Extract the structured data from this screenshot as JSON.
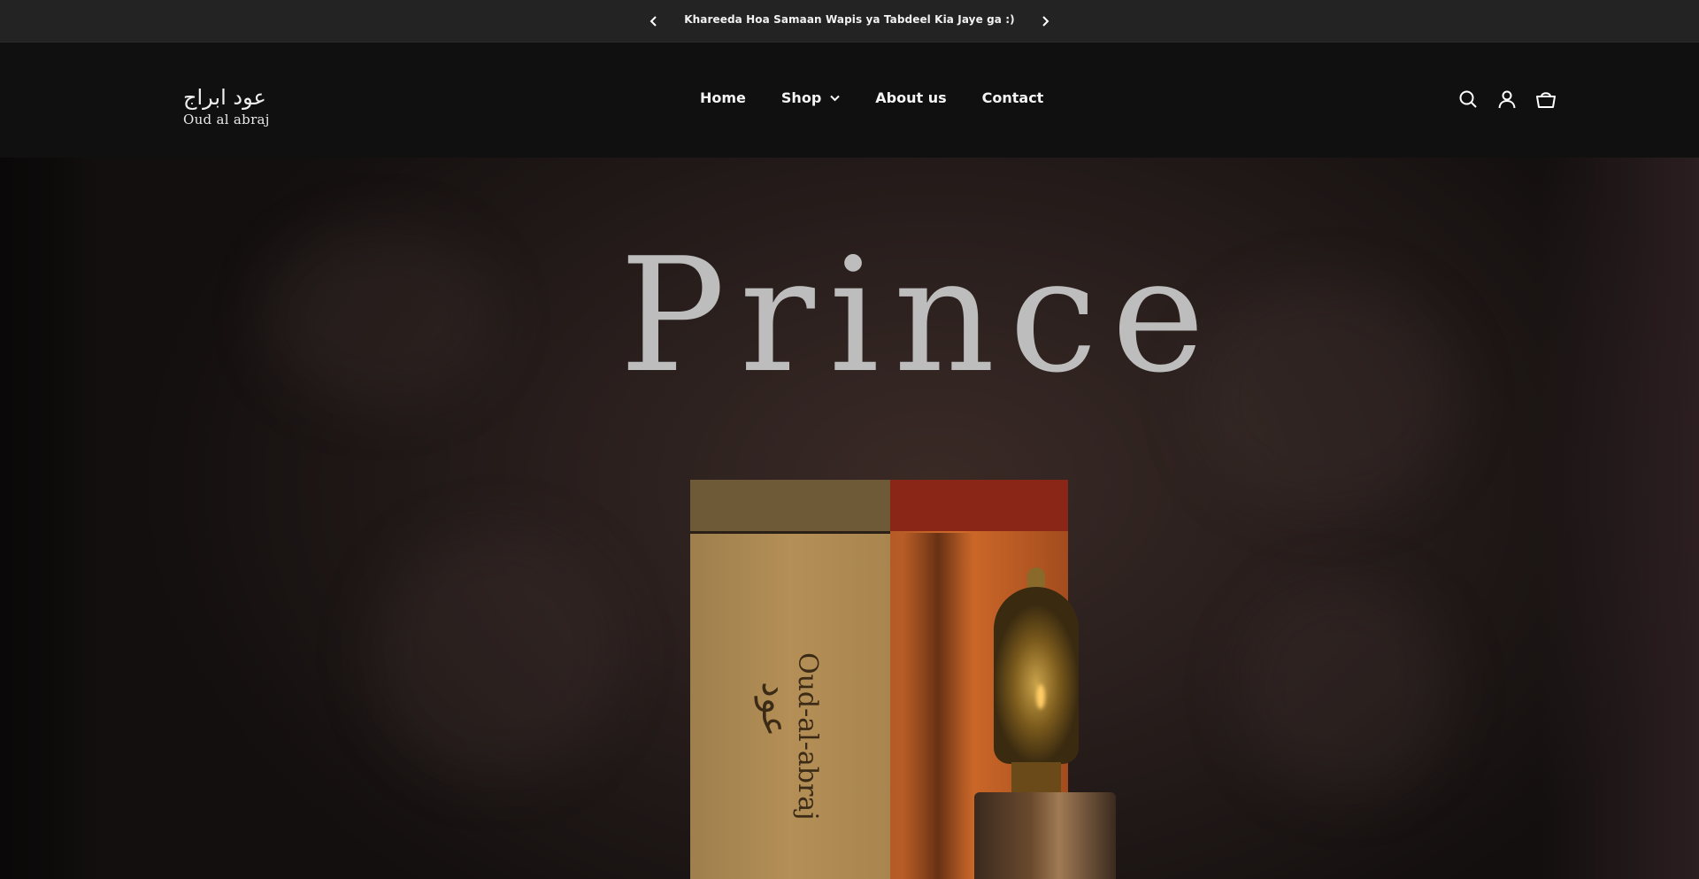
{
  "announcement": {
    "message": "Khareeda Hoa Samaan Wapis ya Tabdeel Kia Jaye ga :)",
    "prev_icon": "chevron-left-icon",
    "next_icon": "chevron-right-icon"
  },
  "header": {
    "logo": {
      "arabic": "عود ابراج",
      "latin": "Oud al abraj"
    },
    "nav": [
      {
        "label": "Home"
      },
      {
        "label": "Shop",
        "has_dropdown": true
      },
      {
        "label": "About us"
      },
      {
        "label": "Contact"
      }
    ],
    "icons": [
      "search-icon",
      "account-icon",
      "cart-icon"
    ]
  },
  "hero": {
    "title": "Prince",
    "product_brand": "Oud-al-abraj",
    "product_brand_ar": "عود"
  },
  "colors": {
    "announcement_bg": "#232323",
    "header_bg": "#101010",
    "hero_title": "#bdbdbd"
  }
}
